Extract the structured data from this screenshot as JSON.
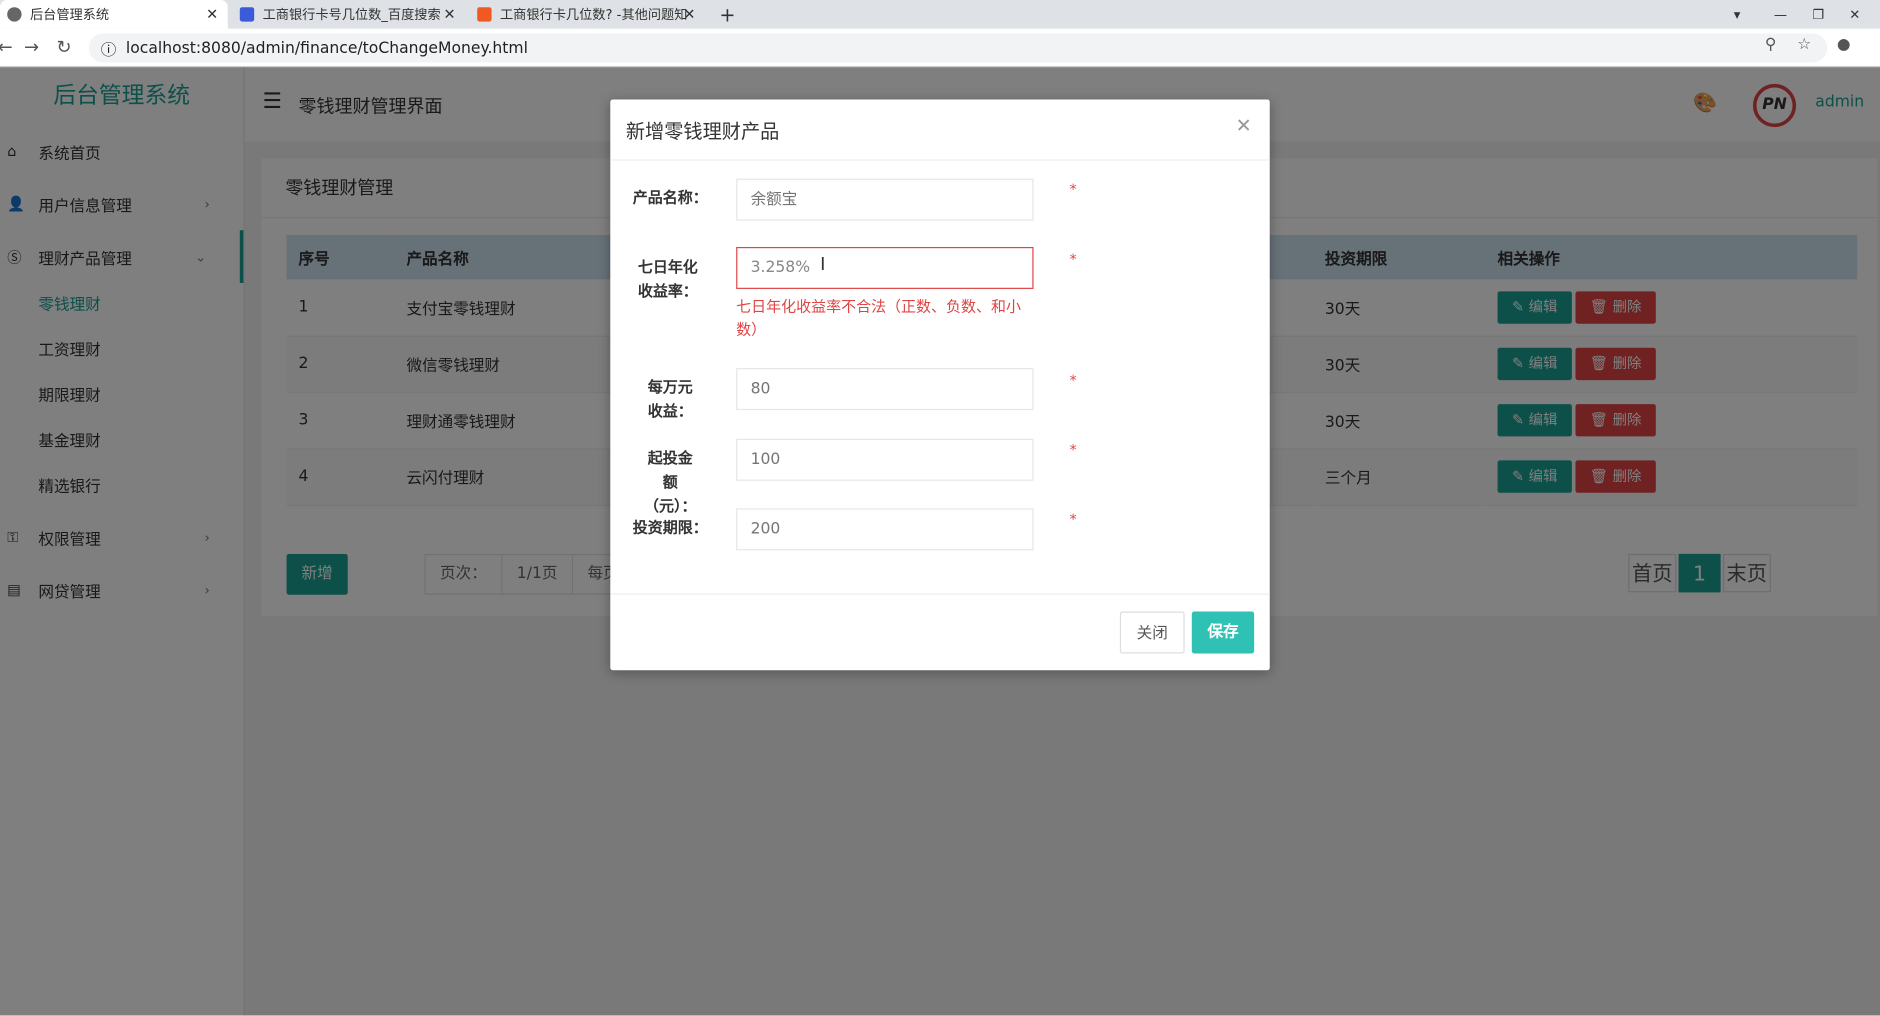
{
  "browser": {
    "tabs": [
      {
        "title": "后台管理系统"
      },
      {
        "title": "工商银行卡号几位数_百度搜索"
      },
      {
        "title": "工商银行卡几位数? -其他问题知"
      }
    ],
    "url": "localhost:8080/admin/finance/toChangeMoney.html"
  },
  "sidebar": {
    "logo": "后台管理系统",
    "items": [
      {
        "label": "系统首页"
      },
      {
        "label": "用户信息管理"
      },
      {
        "label": "理财产品管理"
      },
      {
        "label": "权限管理"
      },
      {
        "label": "网贷管理"
      }
    ],
    "subitems": [
      {
        "label": "零钱理财"
      },
      {
        "label": "工资理财"
      },
      {
        "label": "期限理财"
      },
      {
        "label": "基金理财"
      },
      {
        "label": "精选银行"
      }
    ]
  },
  "header": {
    "title": "零钱理财管理界面",
    "user": "admin"
  },
  "content": {
    "title": "零钱理财管理",
    "columns": [
      "序号",
      "产品名称",
      "投资期限",
      "相关操作"
    ],
    "rows": [
      {
        "id": "1",
        "name": "支付宝零钱理财",
        "term": "30天"
      },
      {
        "id": "2",
        "name": "微信零钱理财",
        "term": "30天"
      },
      {
        "id": "3",
        "name": "理财通零钱理财",
        "term": "30天"
      },
      {
        "id": "4",
        "name": "云闪付理财",
        "term": "三个月"
      }
    ],
    "edit_label": "编辑",
    "delete_label": "删除",
    "new_label": "新增",
    "page_label": "页次：",
    "page_info": "1/1页",
    "per_page": "每页",
    "pager": {
      "first": "首页",
      "current": "1",
      "last": "末页"
    }
  },
  "modal": {
    "title": "新增零钱理财产品",
    "fields": [
      {
        "label": "产品名称：",
        "placeholder": "余额宝"
      },
      {
        "label": "七日年化收益率：",
        "value": "3.258%"
      },
      {
        "label": "每万元收益：",
        "placeholder": "80"
      },
      {
        "label": "起投金额（元）：",
        "placeholder": "100"
      },
      {
        "label": "投资期限：",
        "placeholder": "200"
      }
    ],
    "error": "七日年化收益率不合法（正数、负数、和小数）",
    "required": "*",
    "close": "关闭",
    "save": "保存"
  },
  "colors": {
    "accent": "#1aa094",
    "danger": "#e04545"
  }
}
